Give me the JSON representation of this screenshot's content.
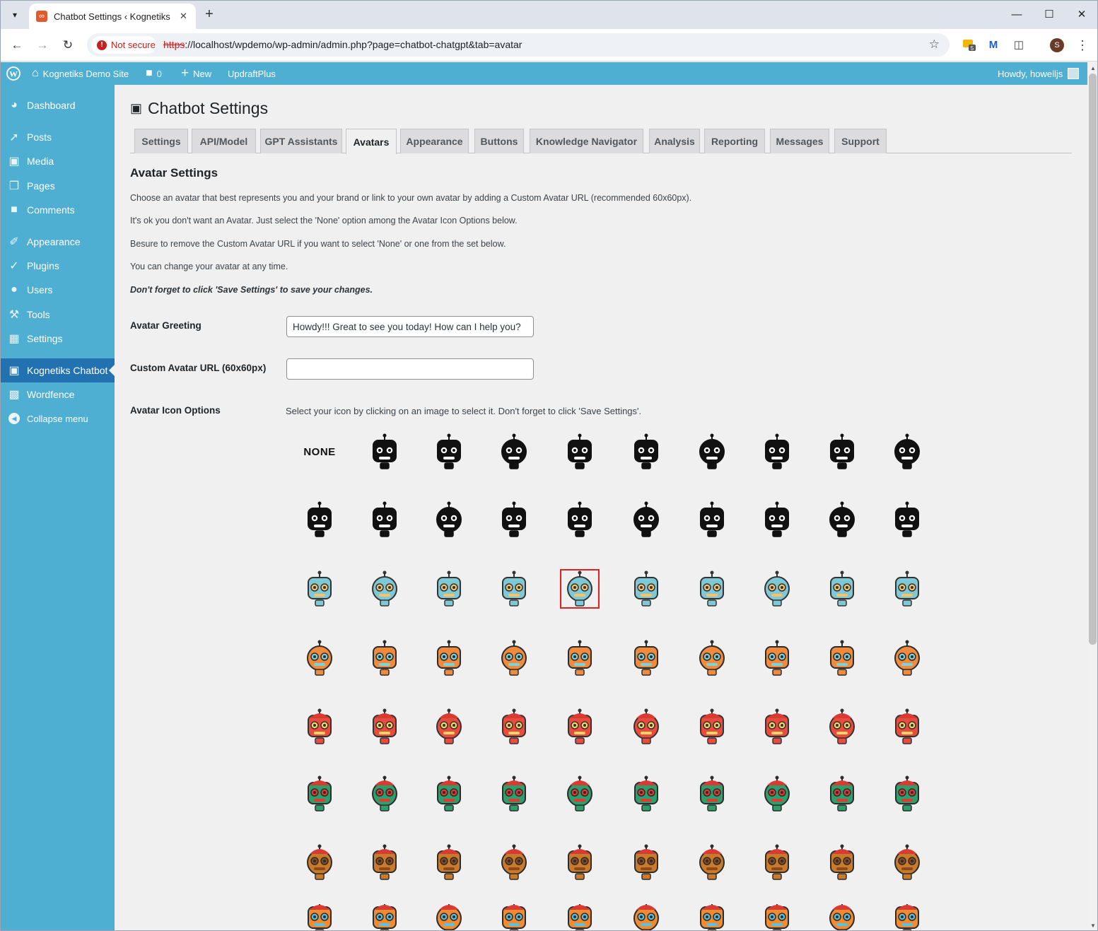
{
  "browser": {
    "tab_title": "Chatbot Settings ‹ Kognetiks D",
    "tab_favicon": "xampp-icon",
    "security_label": "Not secure",
    "url_scheme": "https",
    "url_rest": "://localhost/wpdemo/wp-admin/admin.php?page=chatbot-chatgpt&tab=avatar",
    "profile_initial": "S",
    "extension_badge": "5"
  },
  "adminbar": {
    "site_name": "Kognetiks Demo Site",
    "comments_count": "0",
    "new_label": "New",
    "plugin_label": "UpdraftPlus",
    "greeting": "Howdy, howelljs"
  },
  "sidebar": {
    "items": [
      {
        "label": "Dashboard",
        "icon": "dashboard-icon"
      },
      {
        "label": "Posts",
        "icon": "pin-icon"
      },
      {
        "label": "Media",
        "icon": "media-icon"
      },
      {
        "label": "Pages",
        "icon": "pages-icon"
      },
      {
        "label": "Comments",
        "icon": "comment-icon"
      },
      {
        "label": "Appearance",
        "icon": "brush-icon"
      },
      {
        "label": "Plugins",
        "icon": "plugin-icon"
      },
      {
        "label": "Users",
        "icon": "user-icon"
      },
      {
        "label": "Tools",
        "icon": "wrench-icon"
      },
      {
        "label": "Settings",
        "icon": "settings-icon"
      },
      {
        "label": "Kognetiks Chatbot",
        "icon": "chat-icon"
      },
      {
        "label": "Wordfence",
        "icon": "wordfence-icon"
      },
      {
        "label": "Collapse menu",
        "icon": "collapse-icon"
      }
    ]
  },
  "page": {
    "title": "Chatbot Settings",
    "tabs": [
      "Settings",
      "API/Model",
      "GPT Assistants",
      "Avatars",
      "Appearance",
      "Buttons",
      "Knowledge Navigator",
      "Analysis",
      "Reporting",
      "Messages",
      "Support"
    ],
    "active_tab": "Avatars",
    "section_title": "Avatar Settings",
    "paragraphs": [
      "Choose an avatar that best represents you and your brand or link to your own avatar by adding a Custom Avatar URL (recommended 60x60px).",
      "It's ok you don't want an Avatar. Just select the 'None' option among the Avatar Icon Options below.",
      "Besure to remove the Custom Avatar URL if you want to select 'None' or one from the set below.",
      "You can change your avatar at any time."
    ],
    "reminder": "Don't forget to click 'Save Settings' to save your changes.",
    "greeting_label": "Avatar Greeting",
    "greeting_value": "Howdy!!! Great to see you today! How can I help you?",
    "custom_url_label": "Custom Avatar URL (60x60px)",
    "custom_url_value": "",
    "icon_options_label": "Avatar Icon Options",
    "icon_options_hint": "Select your icon by clicking on an image to select it. Don't forget to click 'Save Settings'.",
    "none_option": "NONE",
    "selected_avatar_index": 24
  },
  "colors": {
    "admin_blue": "#4fafd3",
    "current_menu": "#2271b1",
    "selected_border": "#e0211e"
  }
}
